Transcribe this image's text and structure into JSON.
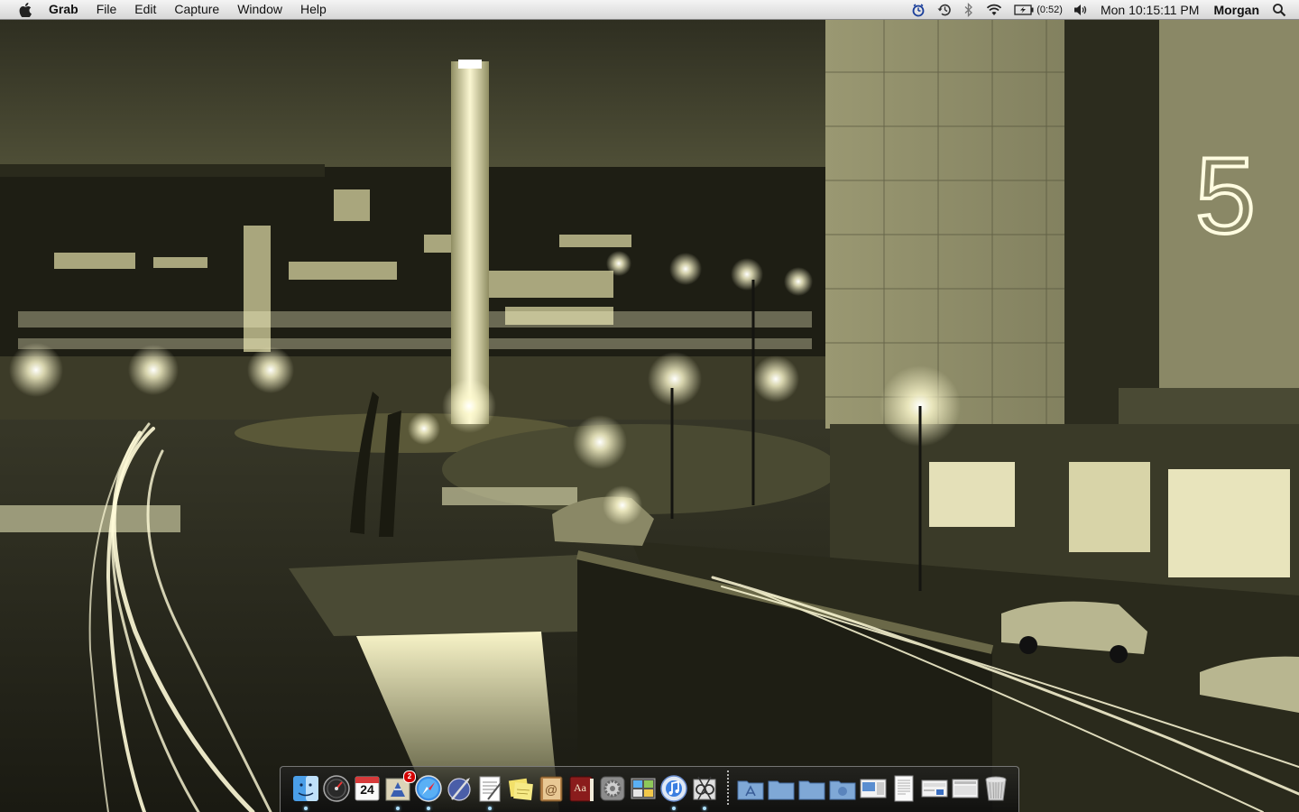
{
  "menubar": {
    "app_name": "Grab",
    "menus": [
      "File",
      "Edit",
      "Capture",
      "Window",
      "Help"
    ],
    "status": {
      "battery_time": "(0:52)",
      "clock": "Mon 10:15:11 PM",
      "user": "Morgan"
    },
    "icons": [
      "apple-icon",
      "timer-icon",
      "time-machine-icon",
      "bluetooth-icon",
      "wifi-icon",
      "battery-icon",
      "volume-icon",
      "spotlight-icon"
    ]
  },
  "wallpaper": {
    "sign_number": "5"
  },
  "dock": {
    "apps": [
      {
        "name": "finder-icon",
        "running": true
      },
      {
        "name": "dashboard-icon",
        "running": false
      },
      {
        "name": "calendar-icon",
        "running": false,
        "day": "24"
      },
      {
        "name": "mail-icon",
        "running": true,
        "badge": "2"
      },
      {
        "name": "safari-icon",
        "running": true
      },
      {
        "name": "script-editor-icon",
        "running": false
      },
      {
        "name": "textedit-icon",
        "running": true
      },
      {
        "name": "stickies-icon",
        "running": false
      },
      {
        "name": "address-book-icon",
        "running": false
      },
      {
        "name": "dictionary-icon",
        "running": false,
        "label": "Aa"
      },
      {
        "name": "system-preferences-icon",
        "running": false
      },
      {
        "name": "activity-monitor-icon",
        "running": false
      },
      {
        "name": "itunes-icon",
        "running": true
      },
      {
        "name": "grab-icon",
        "running": true
      }
    ],
    "stacks": [
      "applications-folder-icon",
      "documents-folder-icon",
      "downloads-folder-icon",
      "home-folder-icon",
      "screenshot-1-icon",
      "document-icon",
      "screenshot-2-icon",
      "screenshot-3-icon",
      "trash-icon"
    ]
  },
  "colors": {
    "menubar_bg": "#e6e6e6",
    "sky": "#2c2c20",
    "glow": "#fffbd0",
    "tint": "#c8c58a"
  }
}
